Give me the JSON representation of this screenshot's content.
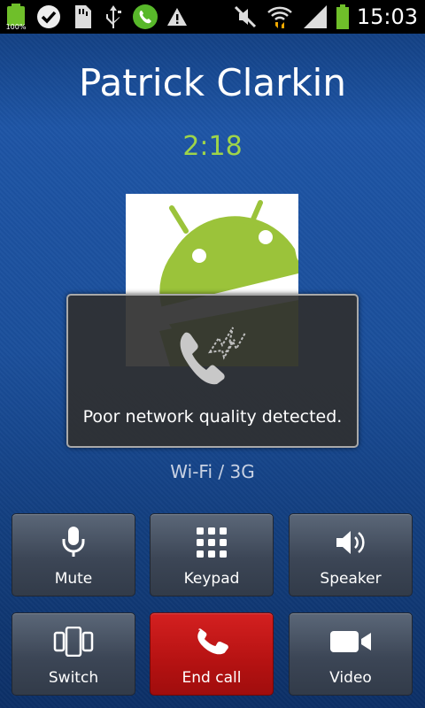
{
  "status_bar": {
    "battery_level_label": "100%",
    "clock": "15:03",
    "icons": [
      "battery-charging-icon",
      "check-icon",
      "sd-card-icon",
      "usb-icon",
      "phone-call-icon",
      "warning-icon",
      "mute-icon",
      "wifi-icon",
      "signal-icon",
      "battery-icon"
    ]
  },
  "call": {
    "caller_name": "Patrick Clarkin",
    "duration": "2:18",
    "network_type": "Wi-Fi / 3G"
  },
  "toast": {
    "message": "Poor network quality detected.",
    "icon": "poor-network-phone-icon"
  },
  "controls": {
    "mute": "Mute",
    "keypad": "Keypad",
    "speaker": "Speaker",
    "switch": "Switch",
    "end_call": "End call",
    "video": "Video"
  },
  "colors": {
    "background": "#1b4f9b",
    "timer": "#9ed44a",
    "end_call": "#c41818",
    "android_green": "#9bc33a"
  }
}
